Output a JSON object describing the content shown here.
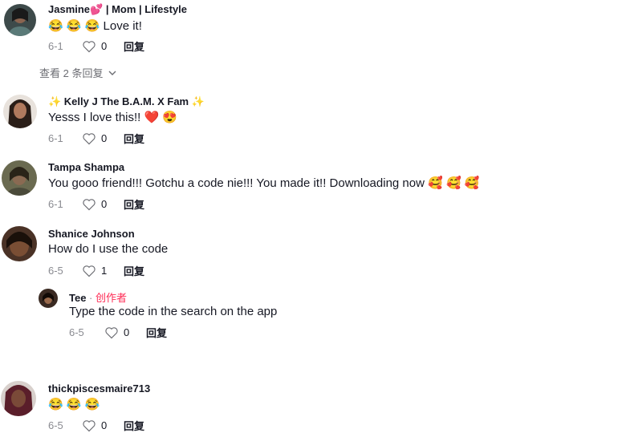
{
  "comments": [
    {
      "username": "Jasmine💕  | Mom | Lifestyle",
      "text": "😂 😂 😂 Love it!",
      "date": "6-1",
      "likes": "0",
      "reply_label": "回复",
      "view_replies": "查看 2 条回复"
    },
    {
      "username": "✨ Kelly  J  The  B.A.M.  X Fam ✨",
      "text": "Yesss I love this!! ❤️ 😍",
      "date": "6-1",
      "likes": "0",
      "reply_label": "回复"
    },
    {
      "username": "Tampa Shampa",
      "text": "You gooo friend!!! Gotchu a code nie!!! You made it!! Downloading now 🥰 🥰 🥰",
      "date": "6-1",
      "likes": "0",
      "reply_label": "回复"
    },
    {
      "username": "Shanice Johnson",
      "text": "How do I use the code",
      "date": "6-5",
      "likes": "1",
      "reply_label": "回复",
      "reply": {
        "username": "Tee",
        "separator": " · ",
        "creator_tag": "创作者",
        "text": "Type the code in the search on the app",
        "date": "6-5",
        "likes": "0",
        "reply_label": "回复"
      }
    },
    {
      "username": "thickpiscesmaire713",
      "text": "😂 😂 😂",
      "date": "6-5",
      "likes": "0",
      "reply_label": "回复"
    }
  ],
  "icons": {
    "like": "heart-outline-icon",
    "expand": "chevron-down-icon"
  },
  "colors": {
    "creator": "#fe2c55",
    "meta": "#8a8b91"
  }
}
